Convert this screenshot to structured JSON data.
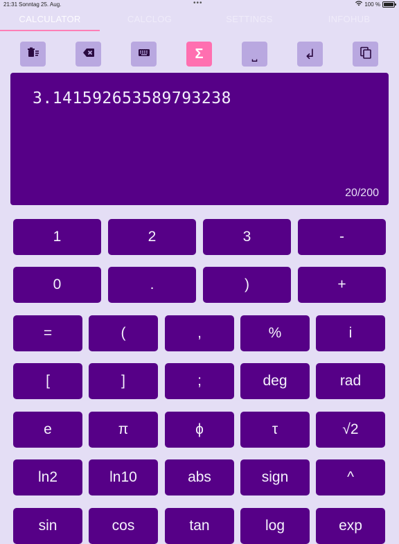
{
  "status_bar": {
    "time": "21:31",
    "date": "Sonntag 25. Aug.",
    "dots": "•••",
    "battery": "100 %"
  },
  "tabs": [
    {
      "label": "CALCULATOR",
      "active": true
    },
    {
      "label": "CALCLOG"
    },
    {
      "label": "SETTINGS"
    },
    {
      "label": "INFOHUB"
    }
  ],
  "toolbar": {
    "items": [
      {
        "icon": "clear-list-icon"
      },
      {
        "icon": "backspace-icon"
      },
      {
        "icon": "keyboard-icon"
      },
      {
        "icon": "sigma-icon",
        "glyph": "Σ",
        "active": true
      },
      {
        "icon": "space-icon",
        "glyph": "⎵"
      },
      {
        "icon": "return-icon",
        "glyph": "↲"
      },
      {
        "icon": "copy-icon"
      }
    ],
    "accent": "#ff6fb0",
    "button_color": "#b9a8e0"
  },
  "display": {
    "value": "3.14159265358979323​8",
    "counter": "20/200"
  },
  "colors": {
    "background": "#e4def5",
    "key": "#560087",
    "key_text": "#f5f2fc"
  },
  "keys_wide": [
    [
      "1",
      "2",
      "3",
      "-"
    ],
    [
      "0",
      ".",
      ")",
      "+"
    ]
  ],
  "keys_narrow": [
    [
      "=",
      "(",
      ",",
      "%",
      "i"
    ],
    [
      "[",
      "]",
      ";",
      "deg",
      "rad"
    ],
    [
      "e",
      "π",
      "ϕ",
      "τ",
      "√2"
    ],
    [
      "ln2",
      "ln10",
      "abs",
      "sign",
      "^"
    ],
    [
      "sin",
      "cos",
      "tan",
      "log",
      "exp"
    ]
  ]
}
